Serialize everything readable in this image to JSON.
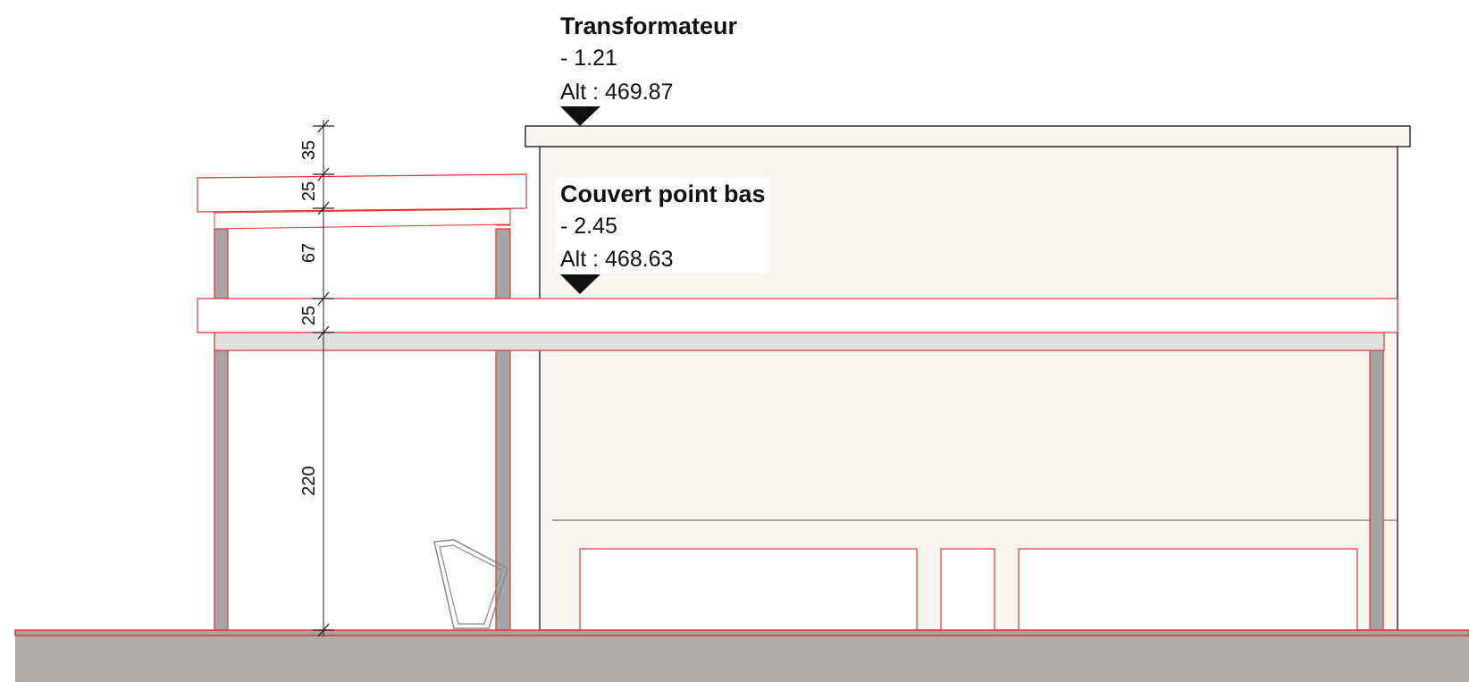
{
  "levels": {
    "transformateur": {
      "title": "Transformateur",
      "offset": "- 1.21",
      "altitude": "Alt : 469.87"
    },
    "couvert_point_bas": {
      "title": "Couvert point bas",
      "offset": "- 2.45",
      "altitude": "Alt : 468.63"
    }
  },
  "dimensions": [
    "35",
    "25",
    "67",
    "25",
    "220"
  ],
  "colors": {
    "outline_red": "#e0342c",
    "wall_fill": "#f9f6f0",
    "ground_fill": "#b1aca7",
    "column_fill": "#a5a5a5",
    "beam_grey": "#e0e0e0"
  }
}
